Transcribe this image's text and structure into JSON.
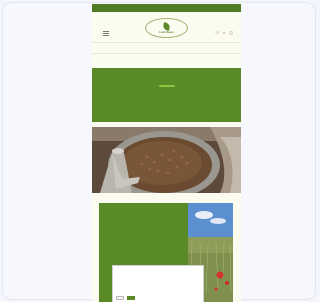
{
  "topbar": {
    "text": ""
  },
  "header": {
    "logo_text": "Landhaus",
    "logo_sub": "",
    "icons": [
      "menu-icon",
      "user-icon",
      "search-icon",
      "cart-icon"
    ]
  },
  "nav": {
    "items": [
      "",
      "",
      "",
      "",
      "",
      ""
    ]
  },
  "hero": {
    "lines": [
      "",
      "",
      ""
    ],
    "cta": "",
    "small": ""
  },
  "feature": {
    "heading": "",
    "body": ""
  },
  "cookie": {
    "title": "",
    "body": "",
    "accept": "",
    "decline": ""
  },
  "colors": {
    "green_dark": "#4e7c21",
    "green": "#5a8a26",
    "cta": "#8cc63f",
    "cream": "#fcfbef"
  }
}
